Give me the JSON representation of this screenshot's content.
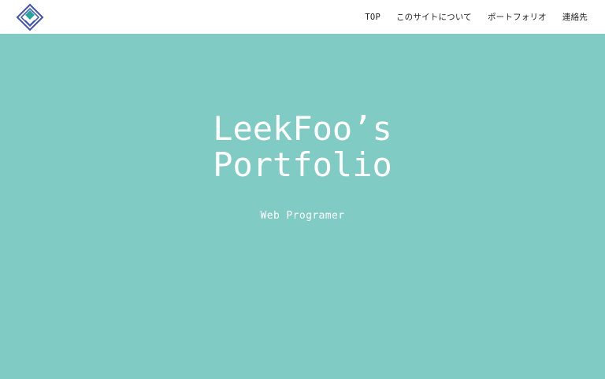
{
  "header": {
    "logo_icon": "diamond-logo-icon",
    "nav": [
      {
        "label": "TOP"
      },
      {
        "label": "このサイトについて"
      },
      {
        "label": "ポートフォリオ"
      },
      {
        "label": "連絡先"
      }
    ]
  },
  "hero": {
    "title_line1": "LeekFoo’s",
    "title_line2": "Portfolio",
    "subtitle": "Web Programer"
  },
  "colors": {
    "hero_background": "#80cbc4",
    "header_background": "#ffffff",
    "logo_outline": "#3f51b5",
    "logo_accent": "#26a69a"
  }
}
